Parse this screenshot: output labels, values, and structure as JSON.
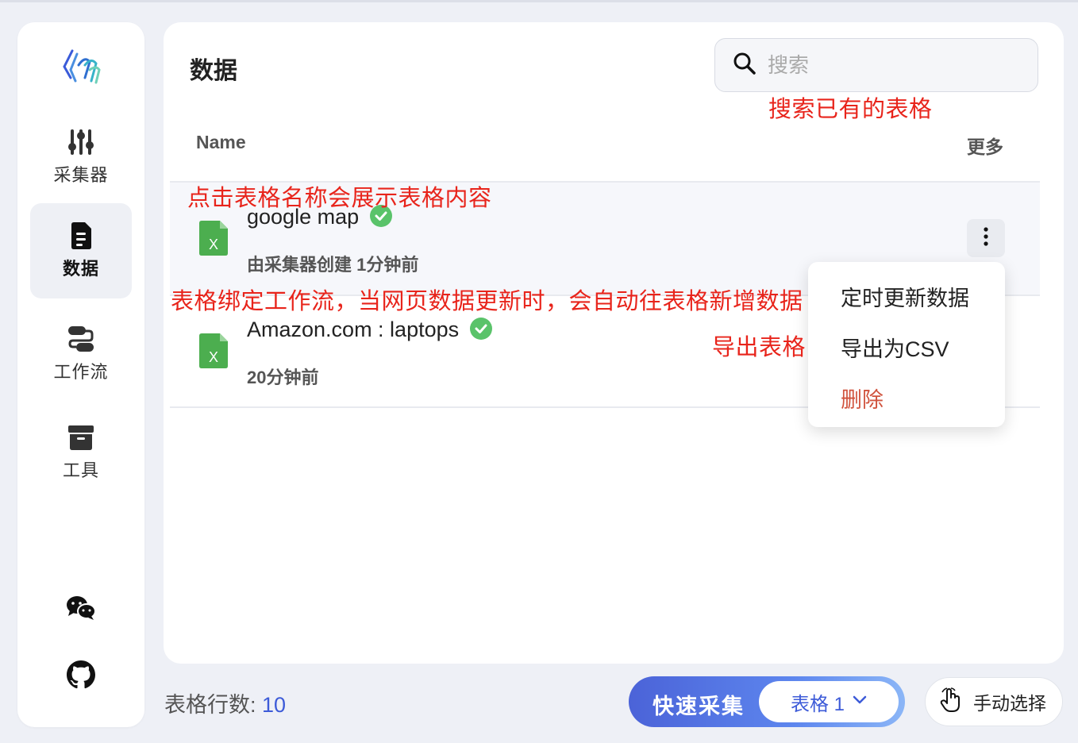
{
  "sidebar": {
    "items": [
      {
        "label": "采集器",
        "icon": "sliders-icon"
      },
      {
        "label": "数据",
        "icon": "document-icon"
      },
      {
        "label": "工作流",
        "icon": "workflow-icon"
      },
      {
        "label": "工具",
        "icon": "archive-box-icon"
      }
    ],
    "footer_icons": [
      "wechat-icon",
      "github-icon"
    ]
  },
  "main": {
    "title": "数据",
    "search_placeholder": "搜索",
    "columns": {
      "name": "Name",
      "more": "更多"
    },
    "rows": [
      {
        "title": "google map",
        "subtitle": "由采集器创建   1分钟前",
        "verified": true
      },
      {
        "title": "Amazon.com : laptops",
        "subtitle": "20分钟前",
        "verified": true
      }
    ]
  },
  "menu": {
    "items": [
      "定时更新数据",
      "导出为CSV",
      "删除"
    ]
  },
  "annotations": {
    "search": "搜索已有的表格",
    "click_name": "点击表格名称会展示表格内容",
    "workflow": "表格绑定工作流，当网页数据更新时，会自动往表格新增数据",
    "export": "导出表格"
  },
  "footer": {
    "row_count_label": "表格行数:",
    "row_count_value": "10",
    "quick_collect_label": "快速采集",
    "table_select_label": "表格 1",
    "manual_select_label": "手动选择"
  },
  "colors": {
    "accent": "#3d5bd8",
    "annotation": "#e8241b",
    "danger": "#d0533d",
    "excel_green": "#4cae4f"
  }
}
